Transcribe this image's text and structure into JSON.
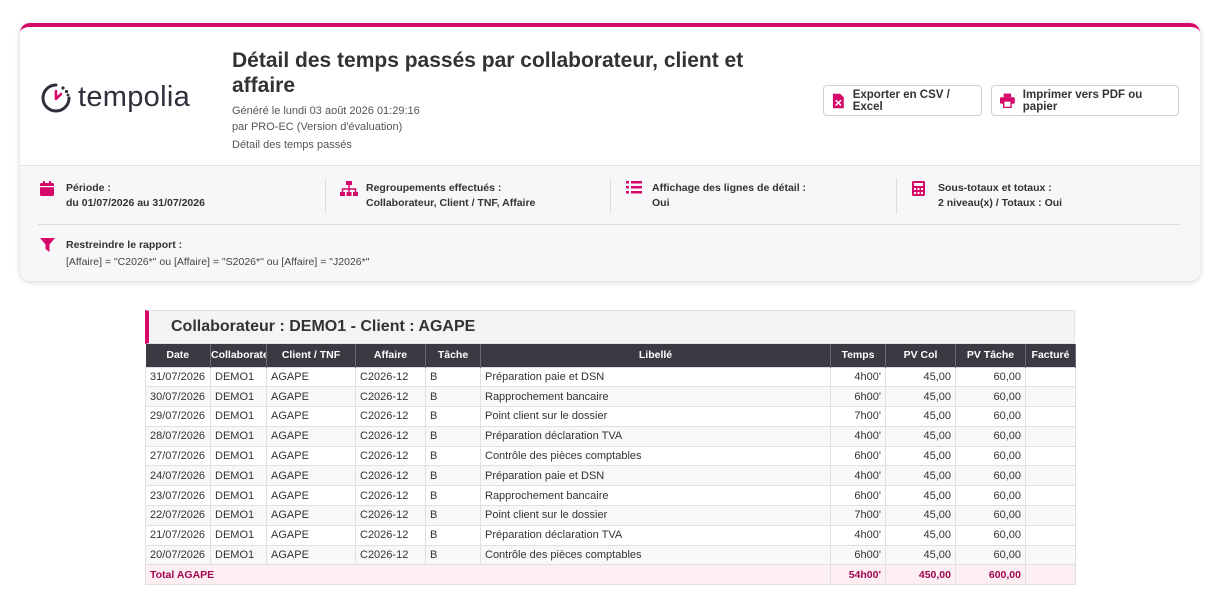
{
  "app": {
    "logo_text": "tempolia"
  },
  "report": {
    "title": "Détail des temps passés par collaborateur, client et affaire",
    "generated": "Généré le lundi 03 août 2026 01:29:16",
    "by": "par PRO-EC (Version d'évaluation)",
    "subtitle": "Détail des temps passés"
  },
  "buttons": {
    "export_csv": "Exporter en CSV / Excel",
    "print_pdf": "Imprimer vers PDF ou papier"
  },
  "info": {
    "periode": {
      "label": "Période :",
      "value": "du 01/07/2026 au 31/07/2026",
      "icon": "calendar-icon"
    },
    "regroupements": {
      "label": "Regroupements effectués :",
      "value": "Collaborateur, Client / TNF, Affaire",
      "icon": "hierarchy-icon"
    },
    "affichage": {
      "label": "Affichage des lignes de détail :",
      "value": "Oui",
      "icon": "list-icon"
    },
    "totaux": {
      "label": "Sous-totaux et totaux :",
      "value": "2 niveau(x) / Totaux : Oui",
      "icon": "calculator-icon"
    },
    "filtre": {
      "label": "Restreindre le rapport :",
      "value": "[Affaire] = \"C2026*\" ou [Affaire] = \"S2026*\" ou [Affaire] = \"J2026*\"",
      "icon": "filter-icon"
    }
  },
  "colors": {
    "accent": "#d6096b",
    "header_bg": "#3a3a43"
  },
  "section": {
    "title": "Collaborateur : DEMO1 - Client : AGAPE",
    "columns": [
      "Date",
      "Collaborateur",
      "Client / TNF",
      "Affaire",
      "Tâche",
      "Libellé",
      "Temps",
      "PV Col",
      "PV Tâche",
      "Facturé"
    ],
    "rows": [
      [
        "31/07/2026",
        "DEMO1",
        "AGAPE",
        "C2026-12",
        "B",
        "Préparation paie et DSN",
        "4h00'",
        "45,00",
        "60,00",
        ""
      ],
      [
        "30/07/2026",
        "DEMO1",
        "AGAPE",
        "C2026-12",
        "B",
        "Rapprochement bancaire",
        "6h00'",
        "45,00",
        "60,00",
        ""
      ],
      [
        "29/07/2026",
        "DEMO1",
        "AGAPE",
        "C2026-12",
        "B",
        "Point client sur le dossier",
        "7h00'",
        "45,00",
        "60,00",
        ""
      ],
      [
        "28/07/2026",
        "DEMO1",
        "AGAPE",
        "C2026-12",
        "B",
        "Préparation déclaration TVA",
        "4h00'",
        "45,00",
        "60,00",
        ""
      ],
      [
        "27/07/2026",
        "DEMO1",
        "AGAPE",
        "C2026-12",
        "B",
        "Contrôle des pièces comptables",
        "6h00'",
        "45,00",
        "60,00",
        ""
      ],
      [
        "24/07/2026",
        "DEMO1",
        "AGAPE",
        "C2026-12",
        "B",
        "Préparation paie et DSN",
        "4h00'",
        "45,00",
        "60,00",
        ""
      ],
      [
        "23/07/2026",
        "DEMO1",
        "AGAPE",
        "C2026-12",
        "B",
        "Rapprochement bancaire",
        "6h00'",
        "45,00",
        "60,00",
        ""
      ],
      [
        "22/07/2026",
        "DEMO1",
        "AGAPE",
        "C2026-12",
        "B",
        "Point client sur le dossier",
        "7h00'",
        "45,00",
        "60,00",
        ""
      ],
      [
        "21/07/2026",
        "DEMO1",
        "AGAPE",
        "C2026-12",
        "B",
        "Préparation déclaration TVA",
        "4h00'",
        "45,00",
        "60,00",
        ""
      ],
      [
        "20/07/2026",
        "DEMO1",
        "AGAPE",
        "C2026-12",
        "B",
        "Contrôle des pièces comptables",
        "6h00'",
        "45,00",
        "60,00",
        ""
      ]
    ],
    "total": {
      "label": "Total AGAPE",
      "temps": "54h00'",
      "pv_col": "450,00",
      "pv_tache": "600,00"
    }
  }
}
